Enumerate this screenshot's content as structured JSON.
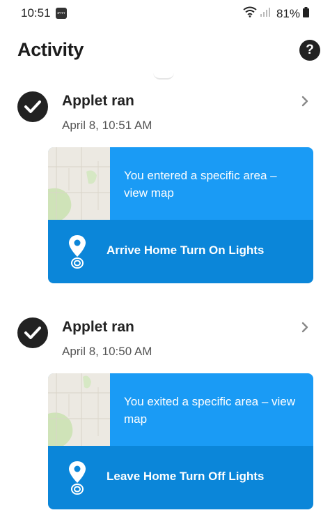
{
  "status_bar": {
    "time": "10:51",
    "app_icon_label": "IFTTT",
    "battery": "81%"
  },
  "header": {
    "title": "Activity",
    "help_label": "?"
  },
  "activities": [
    {
      "title": "Applet ran",
      "date": "April 8, 10:51 AM",
      "trigger_text": "You entered a specific area – view map",
      "applet_name": "Arrive Home Turn On Lights"
    },
    {
      "title": "Applet ran",
      "date": "April 8, 10:50 AM",
      "trigger_text": "You exited a specific area – view map",
      "applet_name": "Leave Home Turn Off Lights"
    }
  ],
  "icons": {
    "status": [
      "wifi-icon",
      "signal-icon",
      "battery-icon"
    ],
    "activity": [
      "check-circle-icon",
      "chevron-right-icon",
      "location-pin-icon"
    ]
  },
  "colors": {
    "card_top": "#1a9bf5",
    "card_bottom": "#0b86d9",
    "dark": "#222222"
  }
}
